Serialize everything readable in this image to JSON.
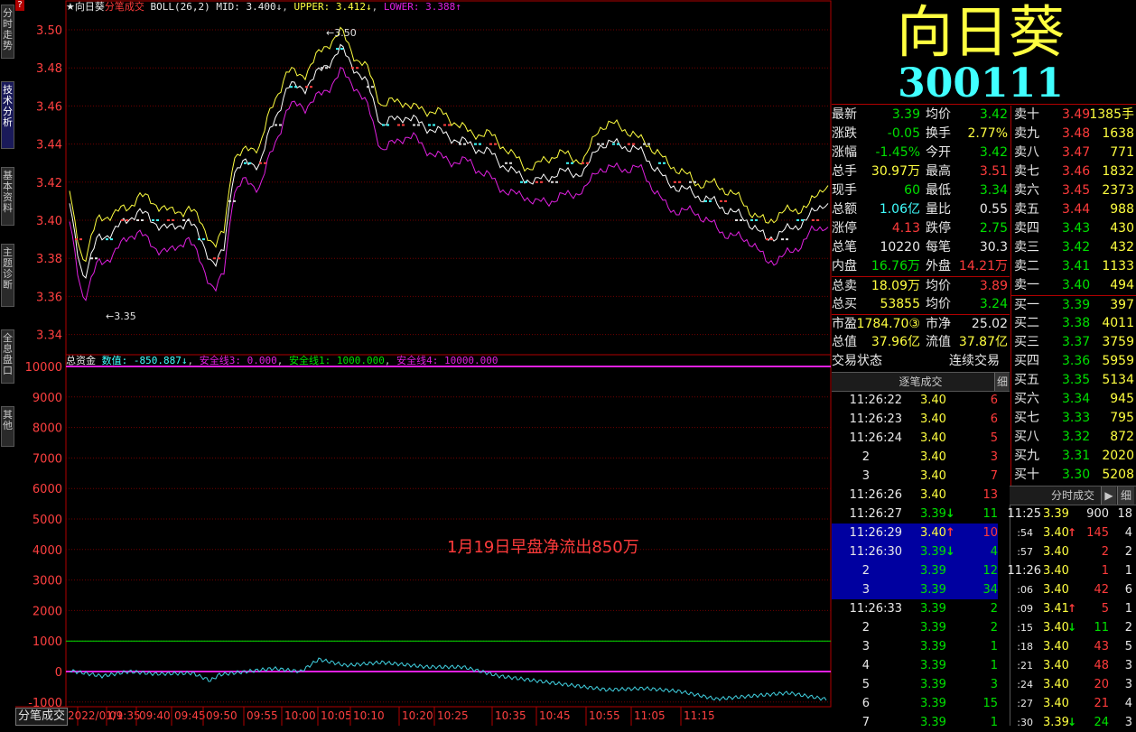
{
  "stock": {
    "name": "向日葵",
    "code": "300111"
  },
  "top_legend": {
    "star": "★向日葵",
    "mode": "分笔成交",
    "boll": "BOLL(26,2)",
    "mid": "MID: 3.400↓",
    "upper": "UPPER: 3.412↓",
    "lower": "LOWER: 3.388↑",
    "help": "?"
  },
  "price_axis": [
    "3.50",
    "3.48",
    "3.46",
    "3.44",
    "3.42",
    "3.40",
    "3.38",
    "3.36",
    "3.34"
  ],
  "price_annotations": {
    "high": "3.50",
    "low": "3.35"
  },
  "flow_legend": {
    "title": "总资金",
    "value": "数值: -850.887↓",
    "line3": "安全线3: 0.000",
    "line1": "安全线1: 1000.000",
    "line4": "安全线4: 10000.000"
  },
  "flow_axis": [
    "10000",
    "9000",
    "8000",
    "7000",
    "6000",
    "5000",
    "4000",
    "3000",
    "2000",
    "1000",
    "0",
    "-1000"
  ],
  "annotation": "1月19日早盘净流出850万",
  "time_axis": [
    "2022/01/1",
    "09:35",
    "09:40",
    "09:45",
    "09:50",
    "09:55",
    "10:00",
    "10:05",
    "10:10",
    "10:20",
    "10:25",
    "10:35",
    "10:45",
    "10:55",
    "11:05",
    "11:15"
  ],
  "bottom_tab": "分笔成交",
  "side_tabs": [
    "分时走势",
    "技术分析",
    "基本资料",
    "主题诊断",
    "全息盘口",
    "其他"
  ],
  "quote": [
    {
      "l1": "最新",
      "v1": "3.39",
      "c1": "g",
      "l2": "均价",
      "v2": "3.42",
      "c2": "g"
    },
    {
      "l1": "涨跌",
      "v1": "-0.05",
      "c1": "g",
      "l2": "换手",
      "v2": "2.77%",
      "c2": "y"
    },
    {
      "l1": "涨幅",
      "v1": "-1.45%",
      "c1": "g",
      "l2": "今开",
      "v2": "3.42",
      "c2": "g"
    },
    {
      "l1": "总手",
      "v1": "30.97万",
      "c1": "y",
      "l2": "最高",
      "v2": "3.51",
      "c2": "r"
    },
    {
      "l1": "现手",
      "v1": "60",
      "c1": "g",
      "l2": "最低",
      "v2": "3.34",
      "c2": "g"
    },
    {
      "l1": "总额",
      "v1": "1.06亿",
      "c1": "c",
      "l2": "量比",
      "v2": "0.55",
      "c2": "w"
    },
    {
      "l1": "涨停",
      "v1": "4.13",
      "c1": "r",
      "l2": "跌停",
      "v2": "2.75",
      "c2": "g"
    },
    {
      "l1": "总笔",
      "v1": "10220",
      "c1": "w",
      "l2": "每笔",
      "v2": "30.3",
      "c2": "w"
    },
    {
      "l1": "内盘",
      "v1": "16.76万",
      "c1": "g",
      "l2": "外盘",
      "v2": "14.21万",
      "c2": "r"
    },
    {
      "l1": "总卖",
      "v1": "18.09万",
      "c1": "y",
      "l2": "均价",
      "v2": "3.89",
      "c2": "r"
    },
    {
      "l1": "总买",
      "v1": "53855",
      "c1": "y",
      "l2": "均价",
      "v2": "3.24",
      "c2": "g"
    },
    {
      "l1": "市盈",
      "v1": "1784.70③",
      "c1": "y",
      "l2": "市净",
      "v2": "25.02",
      "c2": "w"
    },
    {
      "l1": "总值",
      "v1": "37.96亿",
      "c1": "y",
      "l2": "流值",
      "v2": "37.87亿",
      "c2": "y"
    },
    {
      "l1": "交易状态",
      "v1": "",
      "c1": "w",
      "l2": "连续交易",
      "v2": "",
      "c2": "w"
    }
  ],
  "orderbook": [
    {
      "label": "卖十",
      "price": "3.49",
      "vol": "1385手",
      "pc": "r"
    },
    {
      "label": "卖九",
      "price": "3.48",
      "vol": "1638",
      "pc": "r"
    },
    {
      "label": "卖八",
      "price": "3.47",
      "vol": "771",
      "pc": "r"
    },
    {
      "label": "卖七",
      "price": "3.46",
      "vol": "1832",
      "pc": "r"
    },
    {
      "label": "卖六",
      "price": "3.45",
      "vol": "2373",
      "pc": "r"
    },
    {
      "label": "卖五",
      "price": "3.44",
      "vol": "988",
      "pc": "r"
    },
    {
      "label": "卖四",
      "price": "3.43",
      "vol": "430",
      "pc": "g"
    },
    {
      "label": "卖三",
      "price": "3.42",
      "vol": "432",
      "pc": "g"
    },
    {
      "label": "卖二",
      "price": "3.41",
      "vol": "1133",
      "pc": "g"
    },
    {
      "label": "卖一",
      "price": "3.40",
      "vol": "494",
      "pc": "g"
    },
    {
      "label": "买一",
      "price": "3.39",
      "vol": "397",
      "pc": "g"
    },
    {
      "label": "买二",
      "price": "3.38",
      "vol": "4011",
      "pc": "g"
    },
    {
      "label": "买三",
      "price": "3.37",
      "vol": "3759",
      "pc": "g"
    },
    {
      "label": "买四",
      "price": "3.36",
      "vol": "5959",
      "pc": "g"
    },
    {
      "label": "买五",
      "price": "3.35",
      "vol": "5134",
      "pc": "g"
    },
    {
      "label": "买六",
      "price": "3.34",
      "vol": "945",
      "pc": "g"
    },
    {
      "label": "买七",
      "price": "3.33",
      "vol": "795",
      "pc": "g"
    },
    {
      "label": "买八",
      "price": "3.32",
      "vol": "872",
      "pc": "g"
    },
    {
      "label": "买九",
      "price": "3.31",
      "vol": "2020",
      "pc": "g"
    },
    {
      "label": "买十",
      "price": "3.30",
      "vol": "5208",
      "pc": "g"
    }
  ],
  "ticks_header": {
    "title": "逐笔成交",
    "btn": "细"
  },
  "ticks": [
    {
      "t": "11:26:22",
      "p": "3.40",
      "arrow": "",
      "v": "6",
      "vc": "r",
      "sel": false
    },
    {
      "t": "11:26:23",
      "p": "3.40",
      "arrow": "",
      "v": "6",
      "vc": "r",
      "sel": false
    },
    {
      "t": "11:26:24",
      "p": "3.40",
      "arrow": "",
      "v": "5",
      "vc": "r",
      "sel": false
    },
    {
      "t": "2",
      "p": "3.40",
      "arrow": "",
      "v": "3",
      "vc": "r",
      "sel": false
    },
    {
      "t": "3",
      "p": "3.40",
      "arrow": "",
      "v": "7",
      "vc": "r",
      "sel": false
    },
    {
      "t": "11:26:26",
      "p": "3.40",
      "arrow": "",
      "v": "13",
      "vc": "r",
      "sel": false
    },
    {
      "t": "11:26:27",
      "p": "3.39",
      "arrow": "down",
      "v": "11",
      "vc": "g",
      "sel": false
    },
    {
      "t": "11:26:29",
      "p": "3.40",
      "arrow": "up",
      "v": "10",
      "vc": "r",
      "sel": true
    },
    {
      "t": "11:26:30",
      "p": "3.39",
      "arrow": "down",
      "v": "4",
      "vc": "g",
      "sel": true
    },
    {
      "t": "2",
      "p": "3.39",
      "arrow": "",
      "v": "12",
      "vc": "g",
      "sel": true
    },
    {
      "t": "3",
      "p": "3.39",
      "arrow": "",
      "v": "34",
      "vc": "g",
      "sel": true
    },
    {
      "t": "11:26:33",
      "p": "3.39",
      "arrow": "",
      "v": "2",
      "vc": "g",
      "sel": false
    },
    {
      "t": "2",
      "p": "3.39",
      "arrow": "",
      "v": "2",
      "vc": "g",
      "sel": false
    },
    {
      "t": "3",
      "p": "3.39",
      "arrow": "",
      "v": "1",
      "vc": "g",
      "sel": false
    },
    {
      "t": "4",
      "p": "3.39",
      "arrow": "",
      "v": "1",
      "vc": "g",
      "sel": false
    },
    {
      "t": "5",
      "p": "3.39",
      "arrow": "",
      "v": "3",
      "vc": "g",
      "sel": false
    },
    {
      "t": "6",
      "p": "3.39",
      "arrow": "",
      "v": "15",
      "vc": "g",
      "sel": false
    },
    {
      "t": "7",
      "p": "3.39",
      "arrow": "",
      "v": "1",
      "vc": "g",
      "sel": false
    }
  ],
  "minute_header": {
    "title": "分时成交",
    "btn1": "▶",
    "btn2": "细"
  },
  "minute_ticks": [
    {
      "t": "11:25",
      "p": "3.39",
      "arrow": "",
      "v": "900",
      "vc": "w",
      "n": "18"
    },
    {
      "t": ":54",
      "p": "3.40",
      "arrow": "up",
      "v": "145",
      "vc": "r",
      "n": "4"
    },
    {
      "t": ":57",
      "p": "3.40",
      "arrow": "",
      "v": "2",
      "vc": "r",
      "n": "2"
    },
    {
      "t": "11:26",
      "p": "3.40",
      "arrow": "",
      "v": "1",
      "vc": "r",
      "n": "1"
    },
    {
      "t": ":06",
      "p": "3.40",
      "arrow": "",
      "v": "42",
      "vc": "r",
      "n": "6"
    },
    {
      "t": ":09",
      "p": "3.41",
      "arrow": "up",
      "v": "5",
      "vc": "r",
      "n": "1"
    },
    {
      "t": ":15",
      "p": "3.40",
      "arrow": "down",
      "v": "11",
      "vc": "g",
      "n": "2"
    },
    {
      "t": ":18",
      "p": "3.40",
      "arrow": "",
      "v": "43",
      "vc": "r",
      "n": "5"
    },
    {
      "t": ":21",
      "p": "3.40",
      "arrow": "",
      "v": "48",
      "vc": "r",
      "n": "3"
    },
    {
      "t": ":24",
      "p": "3.40",
      "arrow": "",
      "v": "20",
      "vc": "r",
      "n": "3"
    },
    {
      "t": ":27",
      "p": "3.40",
      "arrow": "",
      "v": "21",
      "vc": "r",
      "n": "4"
    },
    {
      "t": ":30",
      "p": "3.39",
      "arrow": "down",
      "v": "24",
      "vc": "g",
      "n": "3"
    }
  ],
  "colors": {
    "border": "#b00000",
    "upper": "#ffff40",
    "mid": "#ffffff",
    "lower": "#e020e0",
    "flow": "#40d0e0",
    "safe1": "#00e000",
    "safe3": "#e020e0",
    "selected": "#0000a0"
  }
}
